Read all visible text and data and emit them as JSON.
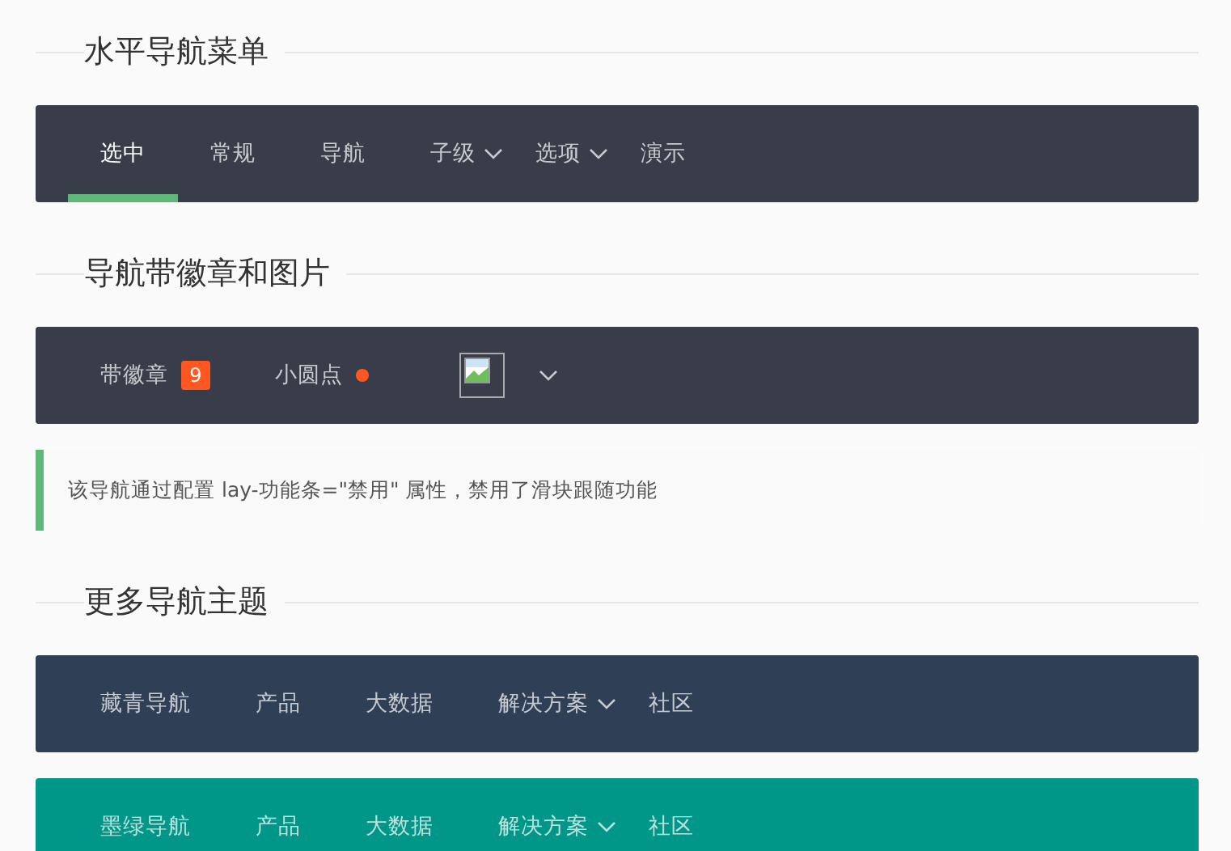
{
  "content": [
    {
      "kind": "heading",
      "title": "水平导航菜单"
    },
    {
      "kind": "nav",
      "color": "#393d49",
      "items": [
        {
          "label": "选中",
          "kind": "plain",
          "dropdown": false,
          "selected": true
        },
        {
          "label": "常规",
          "kind": "plain",
          "dropdown": false,
          "selected": false
        },
        {
          "label": "导航",
          "kind": "plain",
          "dropdown": false,
          "selected": false
        },
        {
          "label": "子级",
          "kind": "plain",
          "dropdown": true,
          "selected": false
        },
        {
          "label": "选项",
          "kind": "plain",
          "dropdown": true,
          "selected": false
        },
        {
          "label": "演示",
          "kind": "plain",
          "dropdown": false,
          "selected": false
        }
      ]
    },
    {
      "kind": "heading",
      "title": "导航带徽章和图片"
    },
    {
      "kind": "nav",
      "color": "#393d49",
      "items": [
        {
          "label": "带徽章",
          "kind": "badge",
          "badge": "9",
          "dropdown": false,
          "selected": false
        },
        {
          "label": "小圆点",
          "kind": "dot",
          "dropdown": false,
          "selected": false
        },
        {
          "kind": "image",
          "dropdown": true,
          "selected": false
        }
      ]
    },
    {
      "kind": "note",
      "text": "该导航通过配置 lay-功能条=\"禁用\" 属性，禁用了滑块跟随功能"
    },
    {
      "kind": "heading",
      "title": "更多导航主题"
    },
    {
      "kind": "nav",
      "color": "#2f4056",
      "items": [
        {
          "label": "藏青导航",
          "kind": "plain",
          "dropdown": false,
          "selected": false
        },
        {
          "label": "产品",
          "kind": "plain",
          "dropdown": false,
          "selected": false
        },
        {
          "label": "大数据",
          "kind": "plain",
          "dropdown": false,
          "selected": false
        },
        {
          "label": "解决方案",
          "kind": "plain",
          "dropdown": true,
          "selected": false
        },
        {
          "label": "社区",
          "kind": "plain",
          "dropdown": false,
          "selected": false
        }
      ]
    },
    {
      "kind": "nav",
      "color": "#009688",
      "items": [
        {
          "label": "墨绿导航",
          "kind": "plain",
          "dropdown": false,
          "selected": false
        },
        {
          "label": "产品",
          "kind": "plain",
          "dropdown": false,
          "selected": false
        },
        {
          "label": "大数据",
          "kind": "plain",
          "dropdown": false,
          "selected": false
        },
        {
          "label": "解决方案",
          "kind": "plain",
          "dropdown": true,
          "selected": false
        },
        {
          "label": "社区",
          "kind": "plain",
          "dropdown": false,
          "selected": false
        }
      ]
    }
  ]
}
